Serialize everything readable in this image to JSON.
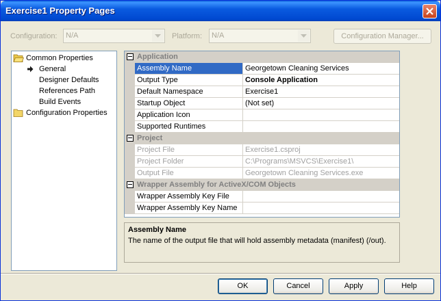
{
  "window": {
    "title": "Exercise1 Property Pages"
  },
  "config_bar": {
    "configuration_label": "Configuration:",
    "configuration_value": "N/A",
    "platform_label": "Platform:",
    "platform_value": "N/A",
    "manager_button": "Configuration Manager..."
  },
  "tree": {
    "common_properties": "Common Properties",
    "general": "General",
    "designer_defaults": "Designer Defaults",
    "references_path": "References Path",
    "build_events": "Build Events",
    "configuration_properties": "Configuration Properties"
  },
  "grid": {
    "application": {
      "category": "Application",
      "rows": [
        {
          "name": "Assembly Name",
          "value": "Georgetown Cleaning Services"
        },
        {
          "name": "Output Type",
          "value": "Console Application"
        },
        {
          "name": "Default Namespace",
          "value": "Exercise1"
        },
        {
          "name": "Startup Object",
          "value": "(Not set)"
        },
        {
          "name": "Application Icon",
          "value": ""
        },
        {
          "name": "Supported Runtimes",
          "value": ""
        }
      ]
    },
    "project": {
      "category": "Project",
      "rows": [
        {
          "name": "Project File",
          "value": "Exercise1.csproj"
        },
        {
          "name": "Project Folder",
          "value": "C:\\Programs\\MSVCS\\Exercise1\\"
        },
        {
          "name": "Output File",
          "value": "Georgetown Cleaning Services.exe"
        }
      ]
    },
    "wrapper": {
      "category": "Wrapper Assembly for ActiveX/COM Objects",
      "rows": [
        {
          "name": "Wrapper Assembly Key File",
          "value": ""
        },
        {
          "name": "Wrapper Assembly Key Name",
          "value": ""
        }
      ]
    }
  },
  "description": {
    "title": "Assembly Name",
    "text": "The name of the output file that will hold assembly metadata (manifest) (/out)."
  },
  "buttons": {
    "ok": "OK",
    "cancel": "Cancel",
    "apply": "Apply",
    "help": "Help"
  },
  "colors": {
    "titlebar": "#0a5be0",
    "selection": "#316ac5",
    "dialog_bg": "#ece9d8"
  },
  "icons": {
    "tree_folder": "folder-open-icon",
    "tree_current": "arrow-right-icon"
  }
}
